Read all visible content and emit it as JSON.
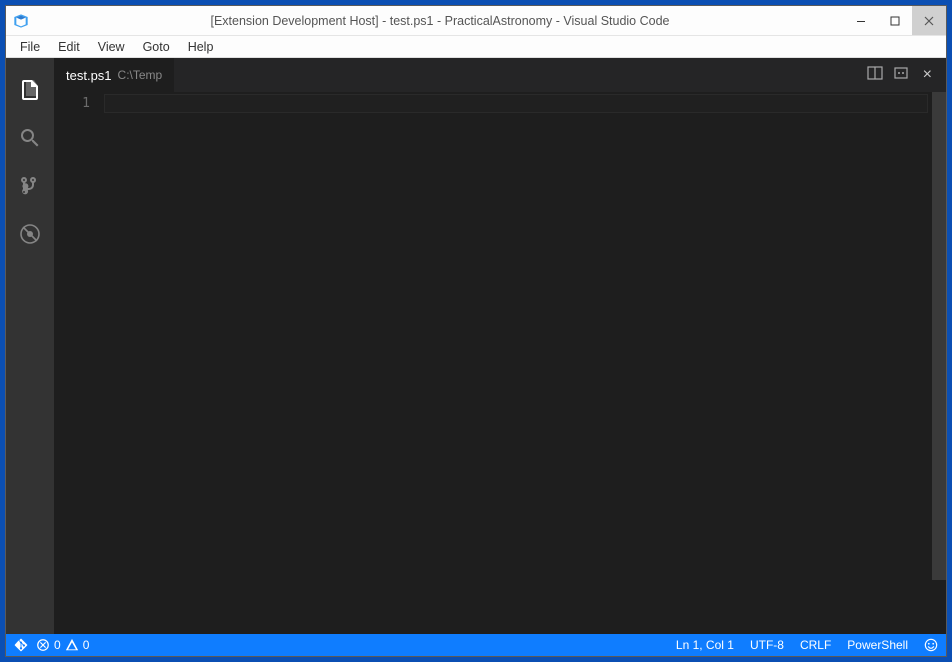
{
  "window": {
    "title": "[Extension Development Host] - test.ps1 - PracticalAstronomy - Visual Studio Code"
  },
  "menu": {
    "file": "File",
    "edit": "Edit",
    "view": "View",
    "goto": "Goto",
    "help": "Help"
  },
  "tab": {
    "filename": "test.ps1",
    "path": "C:\\Temp"
  },
  "editor": {
    "line_number": "1"
  },
  "status": {
    "errors": "0",
    "warnings": "0",
    "cursor": "Ln 1, Col 1",
    "encoding": "UTF-8",
    "eol": "CRLF",
    "language": "PowerShell"
  }
}
